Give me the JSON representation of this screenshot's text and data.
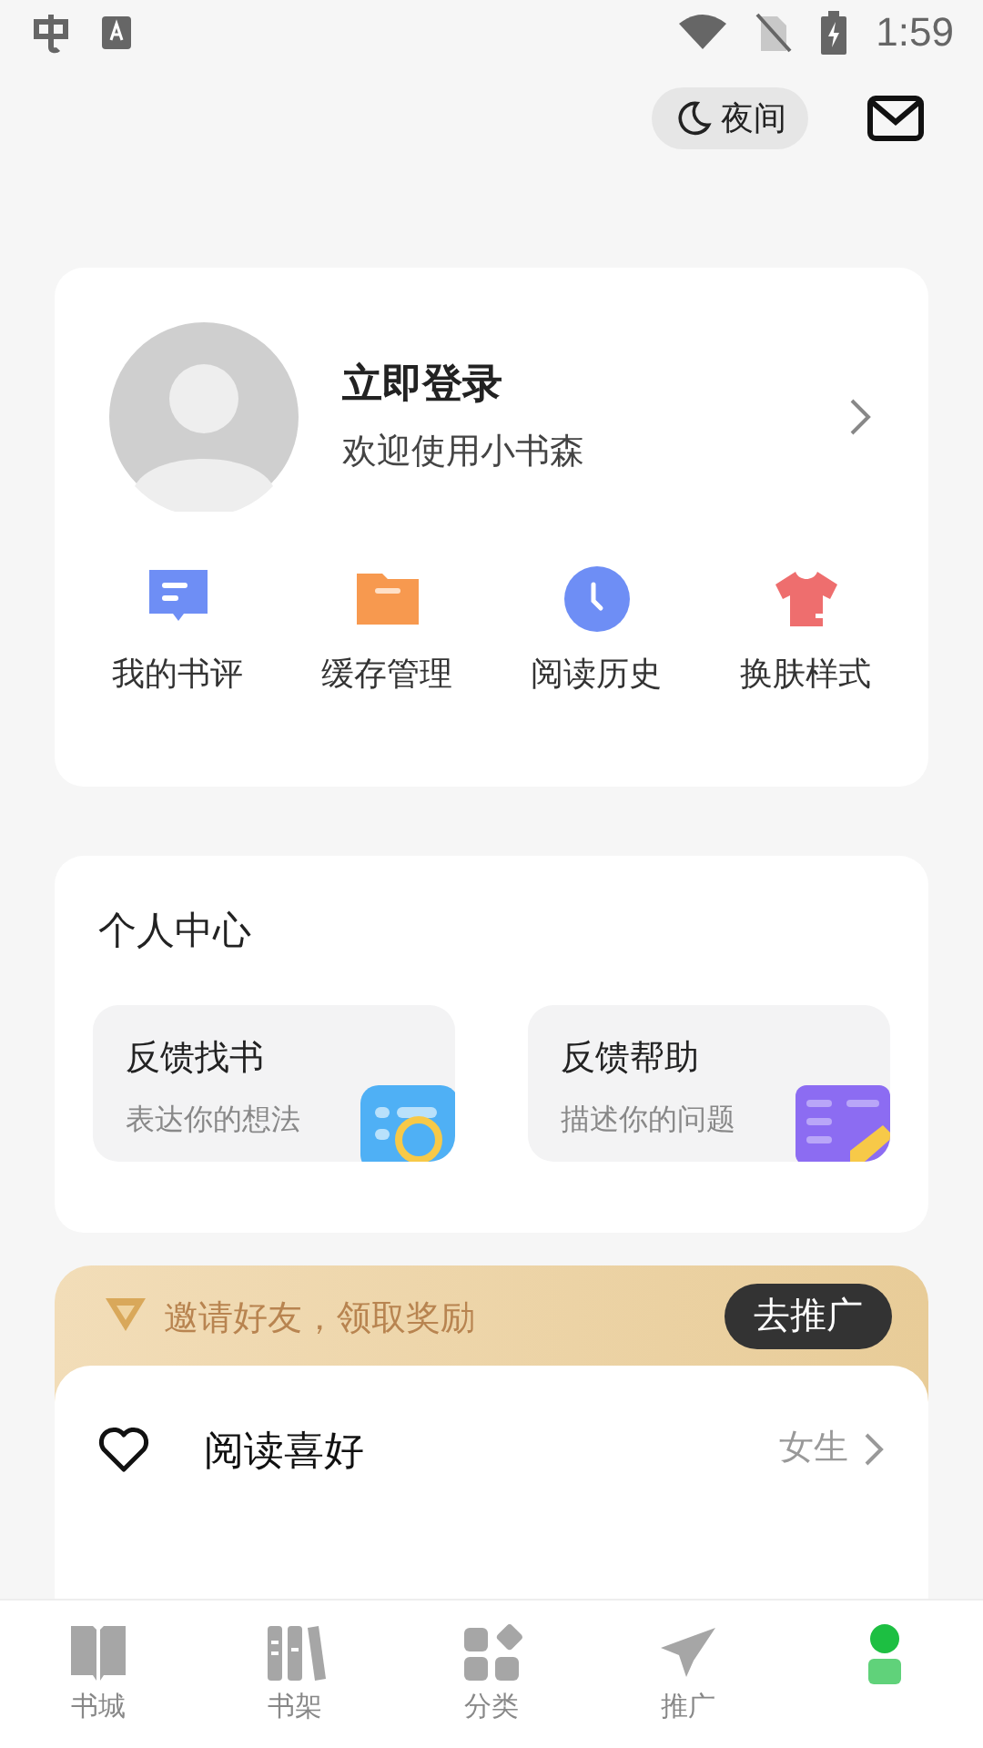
{
  "status_bar": {
    "time": "1:59"
  },
  "header": {
    "night_mode": {
      "label": "夜间",
      "on": false
    }
  },
  "profile": {
    "title": "立即登录",
    "subtitle": "欢迎使用小书森"
  },
  "shortcuts": [
    {
      "kind": "review",
      "label": "我的书评"
    },
    {
      "kind": "cache",
      "label": "缓存管理"
    },
    {
      "kind": "history",
      "label": "阅读历史"
    },
    {
      "kind": "skin",
      "label": "换肤样式"
    }
  ],
  "personal_center": {
    "title": "个人中心",
    "cards": [
      {
        "kind": "find",
        "title": "反馈找书",
        "subtitle": "表达你的想法"
      },
      {
        "kind": "help",
        "title": "反馈帮助",
        "subtitle": "描述你的问题"
      }
    ]
  },
  "invite": {
    "text": "邀请好友，领取奖励",
    "button": "去推广"
  },
  "settings": [
    {
      "label": "阅读喜好",
      "value": "女生"
    }
  ],
  "tabs": [
    {
      "kind": "store",
      "label": "书城",
      "selected": false
    },
    {
      "kind": "shelf",
      "label": "书架",
      "selected": false
    },
    {
      "kind": "category",
      "label": "分类",
      "selected": false
    },
    {
      "kind": "promote",
      "label": "推广",
      "selected": false
    },
    {
      "kind": "me",
      "selected": true
    }
  ]
}
